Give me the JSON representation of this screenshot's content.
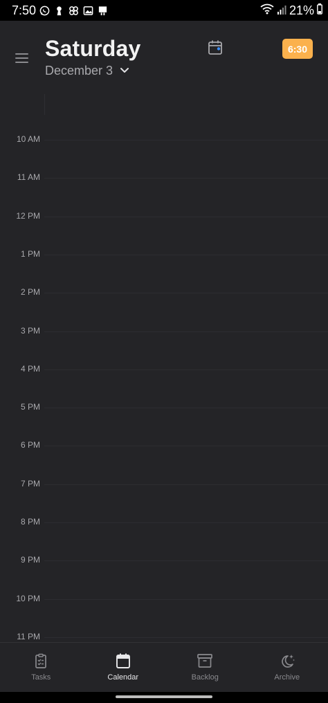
{
  "status_bar": {
    "time": "7:50",
    "battery": "21%"
  },
  "header": {
    "day": "Saturday",
    "date": "December 3",
    "time_badge": "6:30"
  },
  "timeline": {
    "hours": [
      "10 AM",
      "11 AM",
      "12 PM",
      "1 PM",
      "2 PM",
      "3 PM",
      "4 PM",
      "5 PM",
      "6 PM",
      "7 PM",
      "8 PM",
      "9 PM",
      "10 PM",
      "11 PM"
    ]
  },
  "bottom_nav": {
    "items": [
      {
        "label": "Tasks",
        "icon": "clipboard-check-icon"
      },
      {
        "label": "Calendar",
        "icon": "calendar-icon",
        "active": true
      },
      {
        "label": "Backlog",
        "icon": "archive-box-icon"
      },
      {
        "label": "Archive",
        "icon": "moon-stars-icon"
      }
    ]
  },
  "colors": {
    "background": "#242427",
    "accent_badge": "#fbb14d",
    "calendar_dot": "#3d8ef7"
  }
}
